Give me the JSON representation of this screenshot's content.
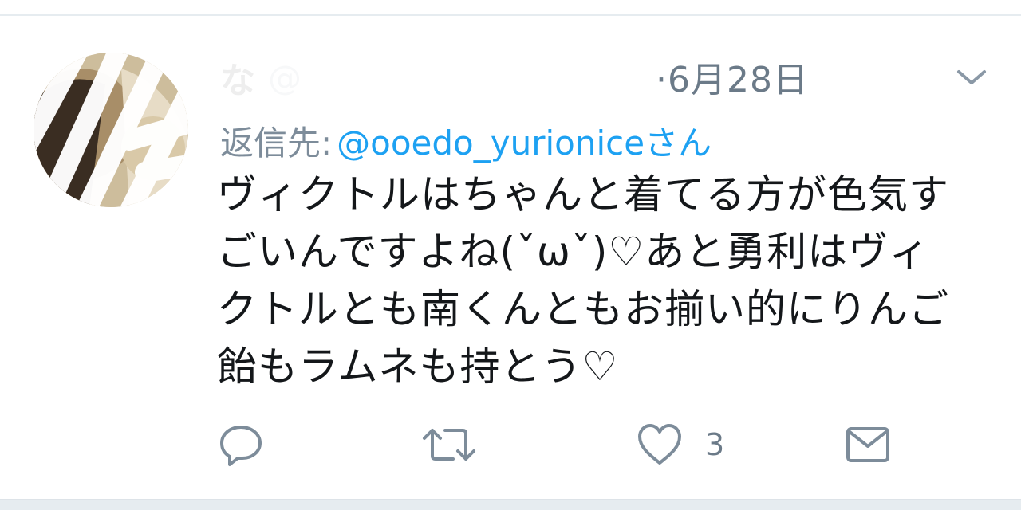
{
  "tweet": {
    "user_name": "な",
    "handle": "@",
    "date_separator": "·",
    "date": "6月28日",
    "reply_prefix": "返信先:",
    "reply_to": "@ooedo_yurioniceさん",
    "text_lines": [
      "ヴィクトルはちゃんと着てる方が色気す",
      "ごいんですよね(ˇωˇ)♡あと勇利はヴィ",
      "クトルとも南くんともお揃い的にりんご",
      "飴もラムネも持とう♡"
    ],
    "like_count": "3"
  },
  "icons": {
    "reply": "reply-icon",
    "retweet": "retweet-icon",
    "like": "heart-icon",
    "dm": "envelope-icon",
    "menu": "chevron-down-icon"
  },
  "colors": {
    "text": "#14171a",
    "secondary": "#7d8c9a",
    "link": "#1da1f2",
    "divider": "#e6ecf0"
  }
}
